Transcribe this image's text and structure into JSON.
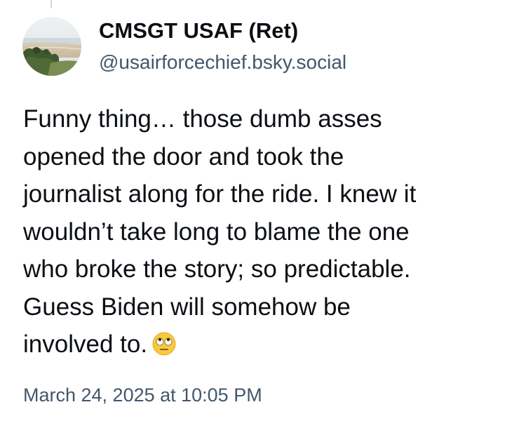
{
  "author": {
    "display_name": "CMSGT USAF (Ret)",
    "handle": "@usairforcechief.bsky.social"
  },
  "post": {
    "lines": [
      "Funny thing… those dumb asses",
      "opened the door and took the",
      "journalist along for the ride. I knew it",
      "wouldn’t take long to blame the one",
      "who broke the story; so predictable.",
      "Guess Biden will somehow be",
      "involved to."
    ],
    "emoji": "face-with-rolling-eyes",
    "timestamp": "March 24, 2025 at 10:05 PM"
  },
  "colors": {
    "text_primary": "#0b0f14",
    "text_secondary": "#42576c",
    "background": "#ffffff",
    "thread_line": "#d4dbe2"
  }
}
